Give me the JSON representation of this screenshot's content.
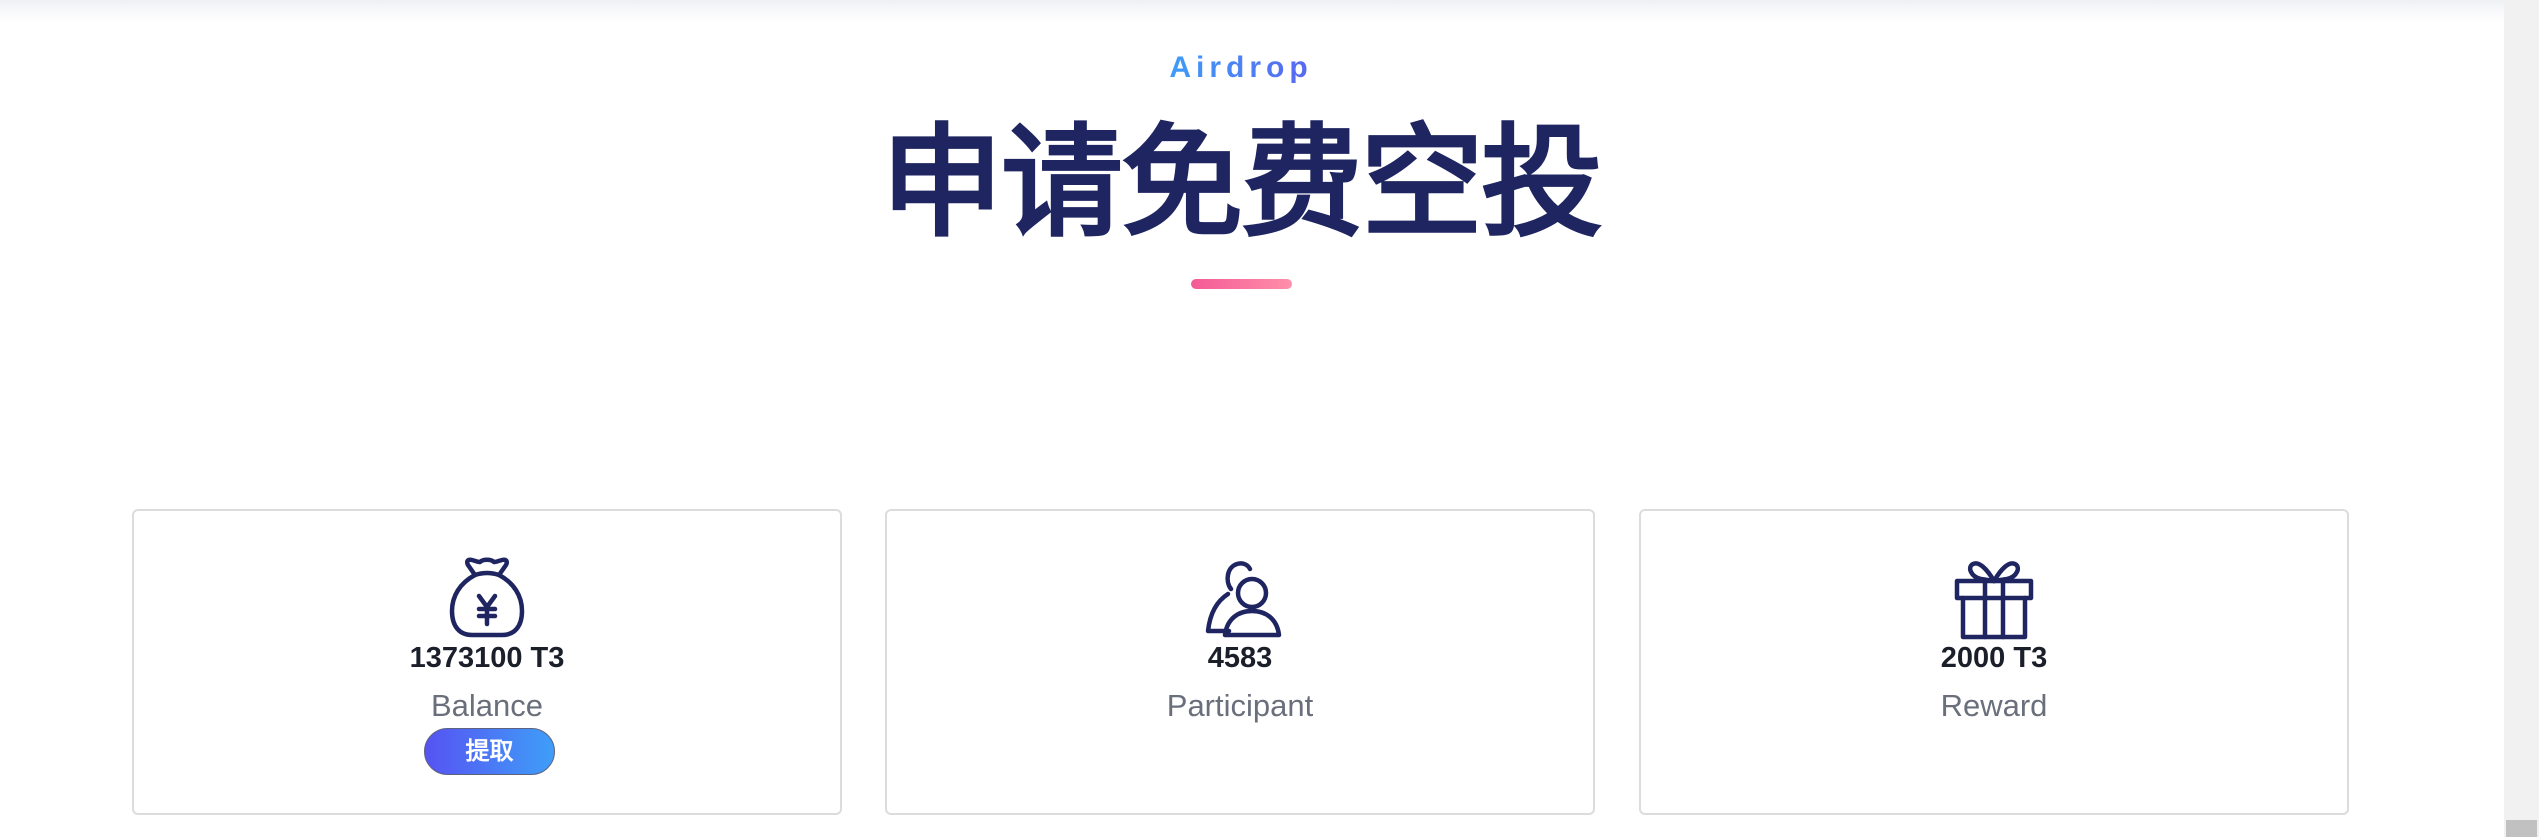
{
  "header": {
    "eyebrow": "Airdrop",
    "title": "申请免费空投"
  },
  "colors": {
    "title": "#1e2560",
    "eyebrow_start": "#3f9cf7",
    "eyebrow_end": "#5967f0",
    "underline_start": "#f45a96",
    "underline_end": "#ff8fa9",
    "button_start": "#5653f2",
    "button_end": "#3f9ef8",
    "icon_stroke": "#1e2560"
  },
  "stats": {
    "balance": {
      "icon": "money-bag-yen-icon",
      "value": "1373100 T3",
      "label": "Balance",
      "action_label": "提取"
    },
    "participants": {
      "icon": "user-icon",
      "value": "4583",
      "label": "Participant"
    },
    "reward": {
      "icon": "gift-icon",
      "value": "2000 T3",
      "label": "Reward"
    }
  }
}
